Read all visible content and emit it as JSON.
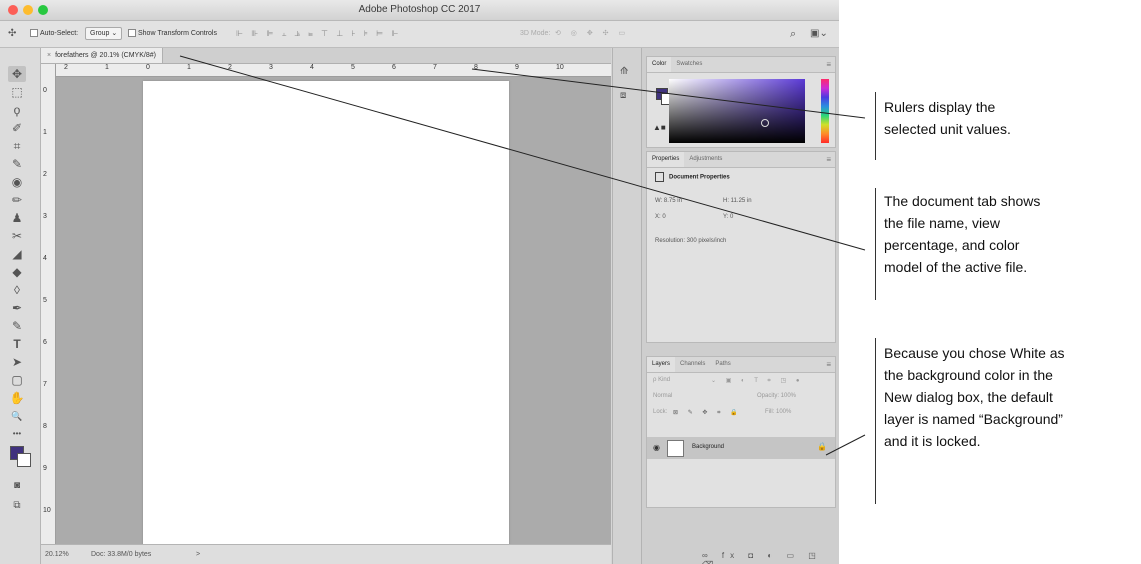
{
  "window": {
    "title": "Adobe Photoshop CC 2017"
  },
  "options_bar": {
    "tool_glyph": "✣",
    "auto_select_label": "Auto-Select:",
    "auto_select_value": "Group",
    "show_transform_label": "Show Transform Controls",
    "mode3d_label": "3D Mode:"
  },
  "tools": [
    "✥",
    "⬚",
    "ϙ",
    "✐",
    "⌗",
    "✎",
    "◉",
    "✏",
    "♟",
    "✂",
    "◢",
    "◆",
    "◊",
    "✒",
    "✎",
    "T",
    "➤",
    "▢",
    "✋",
    "🔍",
    "•••"
  ],
  "foreground_color": "#40327e",
  "document": {
    "tab_label": "forefathers @ 20.1% (CMYK/8#)",
    "close_glyph": "×",
    "h_ruler_labels": [
      "2",
      "1",
      "0",
      "1",
      "2",
      "3",
      "4",
      "5",
      "6",
      "7",
      "8",
      "9",
      "10"
    ],
    "v_ruler_labels": [
      "0",
      "1",
      "2",
      "3",
      "4",
      "5",
      "6",
      "7",
      "8",
      "9",
      "10"
    ],
    "zoom": "20.12%",
    "doc_size": "Doc: 33.8M/0 bytes",
    "status_arrow": ">"
  },
  "color_panel": {
    "tabs": [
      "Color",
      "Swatches"
    ],
    "menu_glyph": "≡"
  },
  "properties_panel": {
    "tabs": [
      "Properties",
      "Adjustments"
    ],
    "title": "Document Properties",
    "width": "W: 8.75 in",
    "height": "H: 11.25 in",
    "x": "X: 0",
    "y": "Y: 0",
    "resolution": "Resolution: 300 pixels/inch"
  },
  "layers_panel": {
    "tabs": [
      "Layers",
      "Channels",
      "Paths"
    ],
    "filter": "ρ Kind",
    "blend_mode": "Normal",
    "opacity": "Opacity: 100%",
    "lock": "Lock:",
    "fill": "Fill: 100%",
    "layer_name": "Background",
    "footer_icons": "∞ fx ◘ ◐ ▭ ◳ ⌫"
  },
  "callouts": {
    "rulers": [
      "Rulers display the",
      "selected unit values."
    ],
    "doc_tab": [
      "The document tab shows",
      "the file name, view",
      "percentage, and color",
      "model of the active file."
    ],
    "background": [
      "Because you chose White as",
      "the background color in the",
      "New dialog box, the default",
      "layer is named “Background”",
      "and it is locked."
    ]
  }
}
